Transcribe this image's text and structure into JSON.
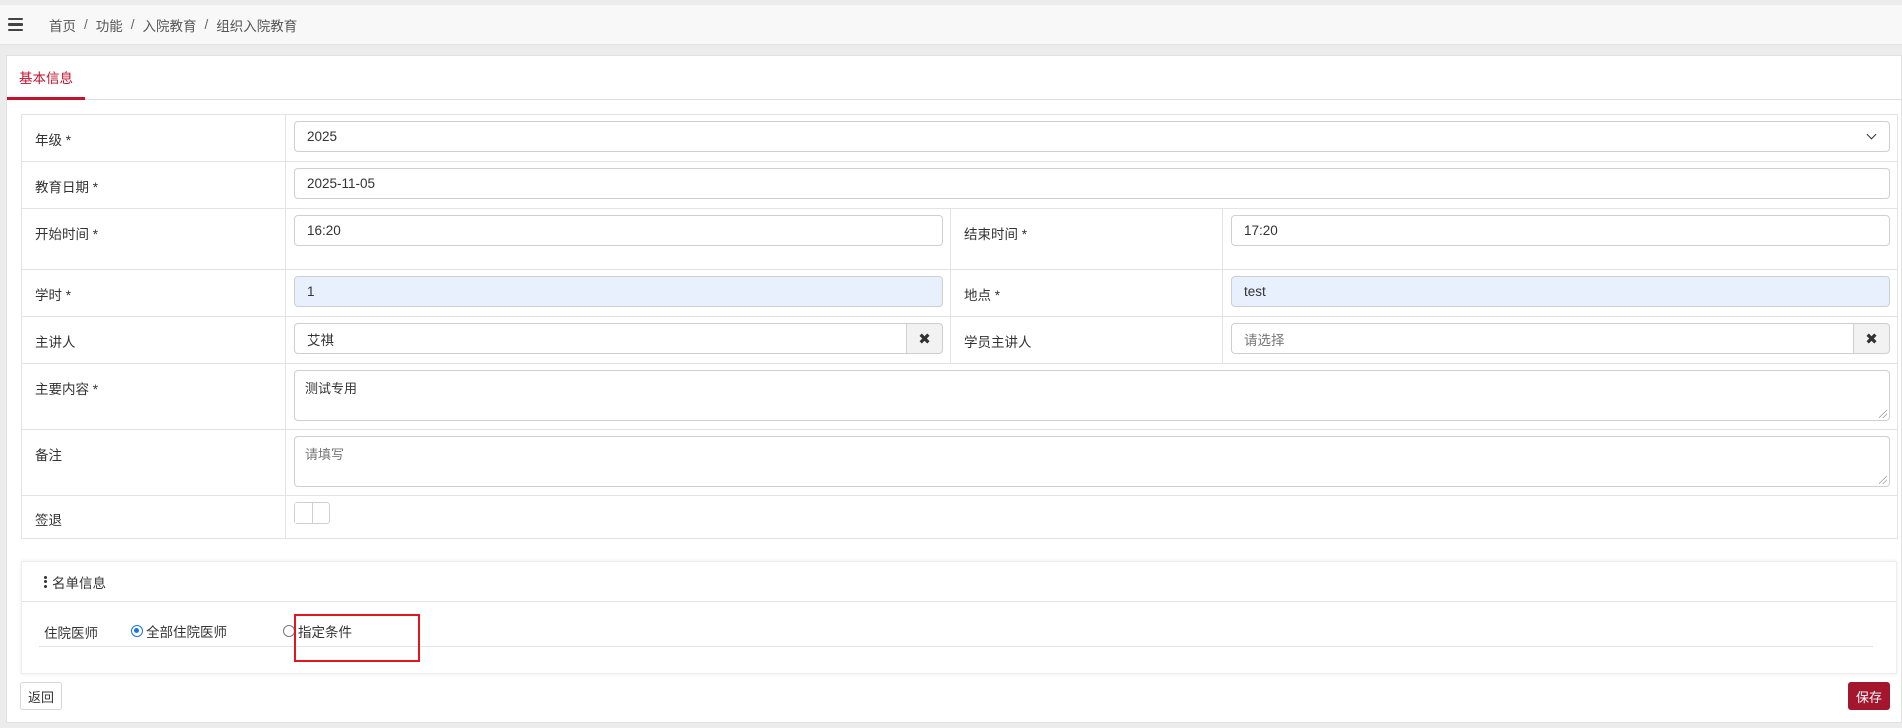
{
  "breadcrumb": [
    "首页",
    "功能",
    "入院教育",
    "组织入院教育"
  ],
  "breadcrumb_separator": "/",
  "tab": {
    "label": "基本信息"
  },
  "form": {
    "grade": {
      "label": "年级 *",
      "value": "2025"
    },
    "edu_date": {
      "label": "教育日期 *",
      "value": "2025-11-05"
    },
    "start_time": {
      "label": "开始时间 *",
      "value": "16:20"
    },
    "end_time": {
      "label": "结束时间 *",
      "value": "17:20"
    },
    "hours": {
      "label": "学时 *",
      "value": "1"
    },
    "location": {
      "label": "地点 *",
      "value": "test"
    },
    "speaker": {
      "label": "主讲人",
      "value": "艾祺"
    },
    "student_speaker": {
      "label": "学员主讲人",
      "placeholder": "请选择"
    },
    "content": {
      "label": "主要内容 *",
      "value": "测试专用"
    },
    "remark": {
      "label": "备注",
      "placeholder": "请填写"
    },
    "signout": {
      "label": "签退",
      "on": false
    }
  },
  "list_section": {
    "title": "名单信息",
    "resident_label": "住院医师",
    "options": [
      {
        "label": "全部住院医师",
        "checked": true
      },
      {
        "label": "指定条件",
        "checked": false
      }
    ]
  },
  "buttons": {
    "back": "返回",
    "save": "保存"
  },
  "colors": {
    "accent": "#c3112e",
    "save": "#a3162e",
    "highlight": "#e0181e",
    "radio": "#1a73e8",
    "autofill": "#e8f0fe"
  }
}
